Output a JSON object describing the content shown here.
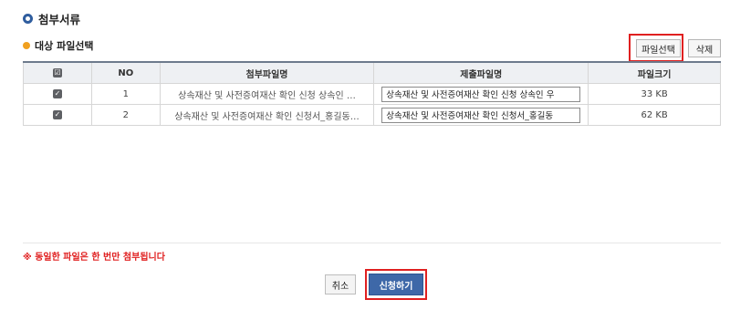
{
  "section": {
    "title": "첨부서류"
  },
  "file_select": {
    "label": "대상 파일선택",
    "select_button": "파일선택",
    "delete_button": "삭제"
  },
  "table": {
    "headers": [
      "☑",
      "NO",
      "첨부파일명",
      "제출파일명",
      "파일크기"
    ],
    "rows": [
      {
        "checked": true,
        "no": "1",
        "attach_name": "상속재산 및 사전증여재산 확인 신청 상속인 …",
        "submit_name": "상속재산 및 사전증여재산 확인 신청 상속인 우",
        "size": "33 KB"
      },
      {
        "checked": true,
        "no": "2",
        "attach_name": "상속재산 및 사전증여재산 확인 신청서_홍길동…",
        "submit_name": "상속재산 및 사전증여재산 확인 신청서_홍길동",
        "size": "62 KB"
      }
    ]
  },
  "notice": "※ 동일한 파일은 한 번만 첨부됩니다",
  "footer": {
    "cancel_button": "취소",
    "apply_button": "신청하기"
  },
  "colors": {
    "accent": "#3e68a8",
    "warning": "#e02020",
    "bullet": "#f0a020"
  }
}
